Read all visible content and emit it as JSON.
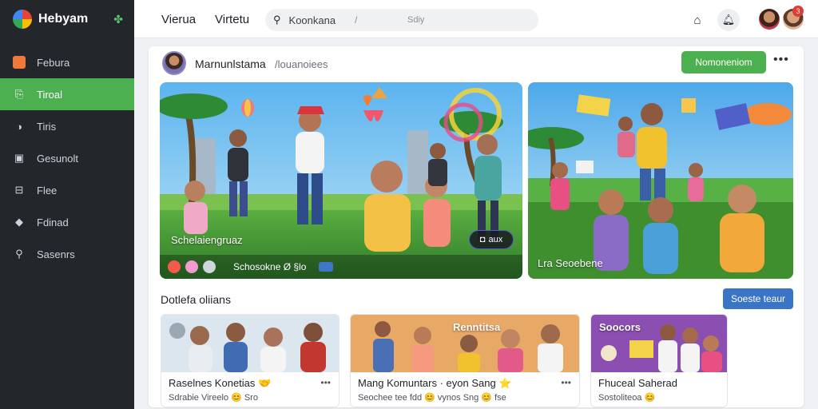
{
  "sidebar": {
    "app_name": "Hebyam",
    "items": [
      {
        "label": "Febura",
        "icon": "home-icon"
      },
      {
        "label": "Tiroal",
        "icon": "feed-icon",
        "active": true
      },
      {
        "label": "Tiris",
        "icon": "info-icon"
      },
      {
        "label": "Gesunolt",
        "icon": "group-icon"
      },
      {
        "label": "Flee",
        "icon": "media-icon"
      },
      {
        "label": "Fdinad",
        "icon": "tag-icon"
      },
      {
        "label": "Sasenrs",
        "icon": "search-icon"
      }
    ]
  },
  "topbar": {
    "links": [
      "Vierua",
      "Virtetu"
    ],
    "search_placeholder": "Koonkana",
    "search_slash": "/",
    "search_extra": "Sdiy",
    "notification_count": "3"
  },
  "post": {
    "author": "Marnunlstama",
    "meta": "/louanoiees",
    "follow_label": "Nomoneniom",
    "more_label": "•••",
    "hero_caption": "Schelaiengruaz",
    "hero_pill": "aux",
    "hero_bottom_text": "Schosokne Ø §lo",
    "hero2_caption": "Lra Seoebene"
  },
  "section": {
    "title": "Dotlefa oliians",
    "button_label": "Soeste teaur"
  },
  "groups": [
    {
      "name": "Raselnes Konetias 🤝",
      "sub": "Sdrabie Vireelo 😊 Sro",
      "more": "•••"
    },
    {
      "name": "Mang Komuntars · eyon Sang ⭐",
      "sub": "Seochee tee fdd 😊 vynos Sng 😊 fse",
      "more": "•••",
      "banner": "Renntitsa"
    },
    {
      "name": "Fhuceal Saherad",
      "sub": "Sostoliteoa 😊",
      "more": "",
      "banner": "Soocors"
    }
  ],
  "colors": {
    "sidebar_bg": "#23262b",
    "accent_green": "#4caf50",
    "accent_blue": "#3a74c6",
    "badge_red": "#e53935"
  }
}
